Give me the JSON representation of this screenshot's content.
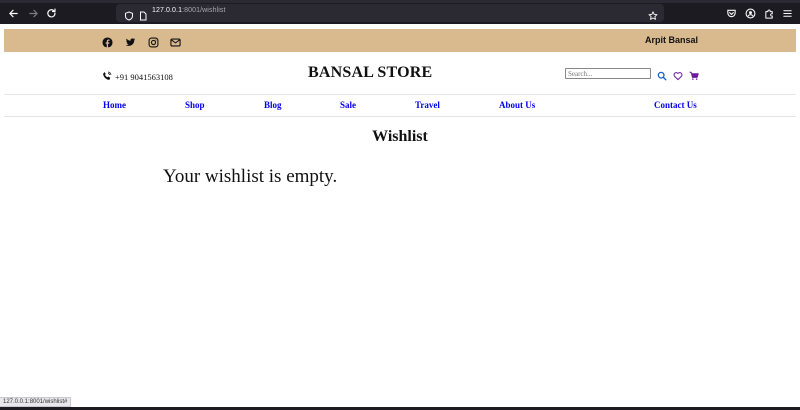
{
  "browser": {
    "url_host": "127.0.0.1",
    "url_path": ":8001/wishlist",
    "status_url": "127.0.0.1:8001/wishlist#",
    "icons": [
      "back-icon",
      "forward-icon",
      "reload-icon",
      "shield-icon",
      "page-icon",
      "bookmark-star-icon",
      "pocket-icon",
      "account-icon",
      "extensions-icon",
      "menu-icon"
    ]
  },
  "topbar": {
    "bg_color": "#d9b98e",
    "social_icons": [
      "facebook-icon",
      "twitter-icon",
      "instagram-icon",
      "mail-icon"
    ],
    "user_name": "Arpit Bansal"
  },
  "header": {
    "phone": "+91 9041563108",
    "brand": "BANSAL STORE",
    "search_placeholder": "Search...",
    "icons": [
      "search-icon",
      "heart-icon",
      "cart-icon"
    ]
  },
  "nav": {
    "link_color": "#0000ee",
    "items": [
      {
        "label": "Home"
      },
      {
        "label": "Shop"
      },
      {
        "label": "Blog"
      },
      {
        "label": "Sale"
      },
      {
        "label": "Travel"
      },
      {
        "label": "About Us"
      },
      {
        "label": "Contact Us"
      }
    ]
  },
  "main": {
    "title": "Wishlist",
    "empty_message": "Your wishlist is empty."
  }
}
